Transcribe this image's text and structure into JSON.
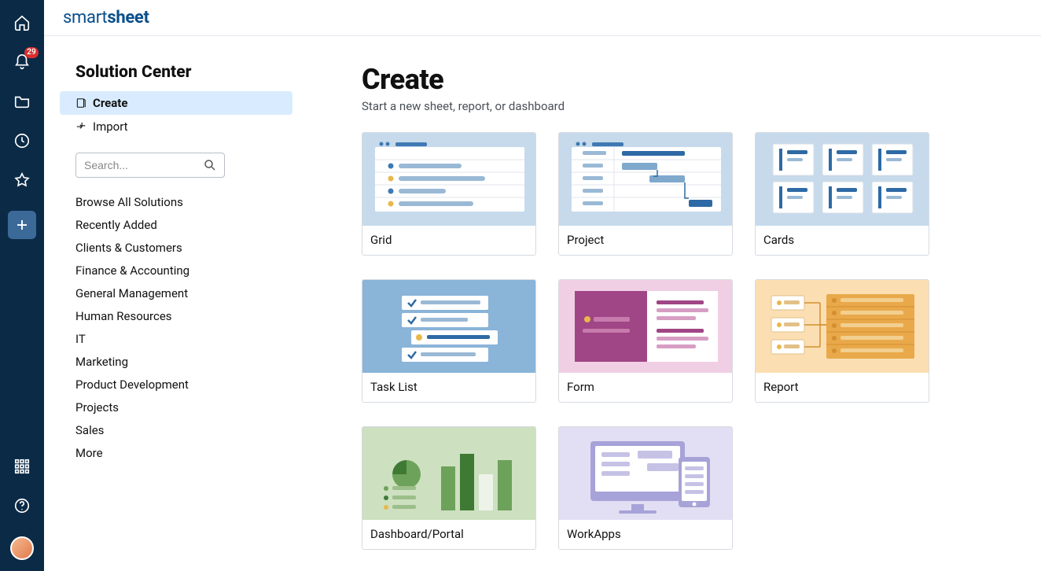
{
  "brand": {
    "part1": "smart",
    "part2": "sheet"
  },
  "rail": {
    "notifications_count": "29"
  },
  "panel": {
    "title": "Solution Center",
    "nav": {
      "create": "Create",
      "import": "Import"
    },
    "search_placeholder": "Search...",
    "categories": [
      "Browse All Solutions",
      "Recently Added",
      "Clients & Customers",
      "Finance & Accounting",
      "General Management",
      "Human Resources",
      "IT",
      "Marketing",
      "Product Development",
      "Projects",
      "Sales",
      "More"
    ]
  },
  "main": {
    "title": "Create",
    "subtitle": "Start a new sheet, report, or dashboard",
    "cards": {
      "grid": "Grid",
      "project": "Project",
      "cards": "Cards",
      "task_list": "Task List",
      "form": "Form",
      "report": "Report",
      "dashboard": "Dashboard/Portal",
      "workapps": "WorkApps"
    }
  }
}
